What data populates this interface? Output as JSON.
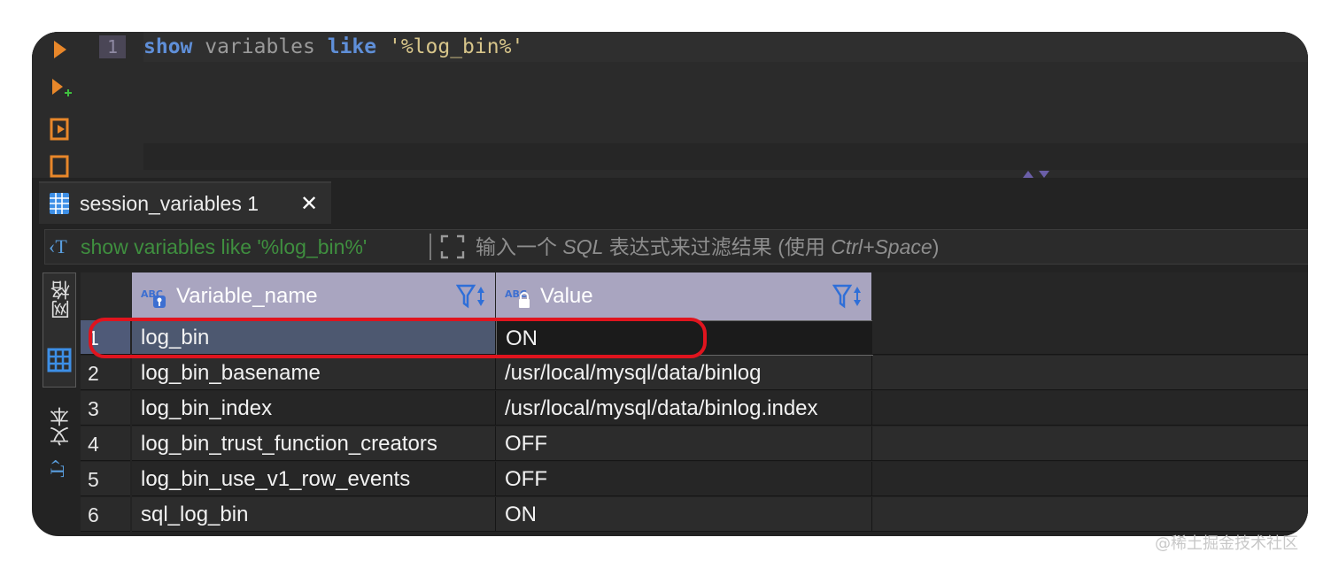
{
  "editor": {
    "line_number": "1",
    "code": {
      "kw1": "show",
      "word": " variables ",
      "kw2": "like",
      "space": " ",
      "str": "'%log_bin%'"
    }
  },
  "tab": {
    "label": "session_variables 1",
    "close": "✕"
  },
  "filter": {
    "icon": "‹T",
    "query": "show variables like '%log_bin%'",
    "placeholder_prefix": "输入一个 ",
    "placeholder_sql": "SQL",
    "placeholder_mid": " 表达式来过滤结果 (使用 ",
    "placeholder_key": "Ctrl+Space",
    "placeholder_end": ")"
  },
  "side_tabs": {
    "grid": "网格",
    "text": "文本"
  },
  "table": {
    "columns": [
      {
        "label": "Variable_name"
      },
      {
        "label": "Value"
      }
    ],
    "rows": [
      {
        "num": "1",
        "name": "log_bin",
        "value": "ON"
      },
      {
        "num": "2",
        "name": "log_bin_basename",
        "value": "/usr/local/mysql/data/binlog"
      },
      {
        "num": "3",
        "name": "log_bin_index",
        "value": "/usr/local/mysql/data/binlog.index"
      },
      {
        "num": "4",
        "name": "log_bin_trust_function_creators",
        "value": "OFF"
      },
      {
        "num": "5",
        "name": "log_bin_use_v1_row_events",
        "value": "OFF"
      },
      {
        "num": "6",
        "name": "sql_log_bin",
        "value": "ON"
      }
    ]
  },
  "watermark": "@稀土掘金技术社区",
  "colors": {
    "accent_orange": "#e8872a",
    "header_bg": "#a9a5c0",
    "highlight_red": "#e0141e",
    "query_green": "#3f8f3f"
  }
}
